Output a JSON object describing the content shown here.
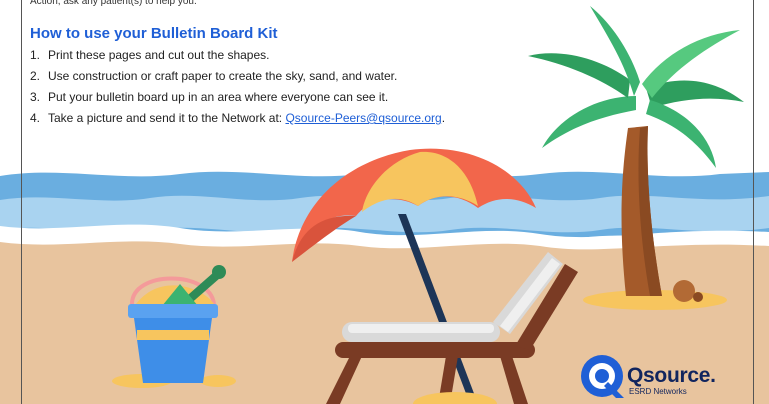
{
  "intro": {
    "line_partial": "Action, ask any patient(s) to help you."
  },
  "instructions": {
    "heading": "How to use your Bulletin Board Kit",
    "steps": [
      {
        "number": "1.",
        "text": "Print these pages and cut out the shapes."
      },
      {
        "number": "2.",
        "text": "Use construction or craft paper to create the sky, sand, and water."
      },
      {
        "number": "3.",
        "text": "Put your bulletin board up in an area where everyone can see it."
      },
      {
        "number": "4.",
        "text": "Take a picture and send it to the Network at: ",
        "link_text": "Qsource-Peers@qsource.org",
        "suffix": "."
      }
    ]
  },
  "logo": {
    "name": "Qsource",
    "trademark": ".",
    "subtitle": "ESRD Networks",
    "color": "#1f5fd6"
  },
  "colors": {
    "heading": "#1f5fd6",
    "sand": "#e8c49e",
    "water_dark": "#6aaee0",
    "water_light": "#a9d3f0",
    "umbrella_red": "#f2664b",
    "umbrella_yellow": "#f7c55e",
    "palm_green": "#3cb371",
    "trunk_brown": "#a45a2a",
    "bucket_blue": "#3e8ee8"
  }
}
